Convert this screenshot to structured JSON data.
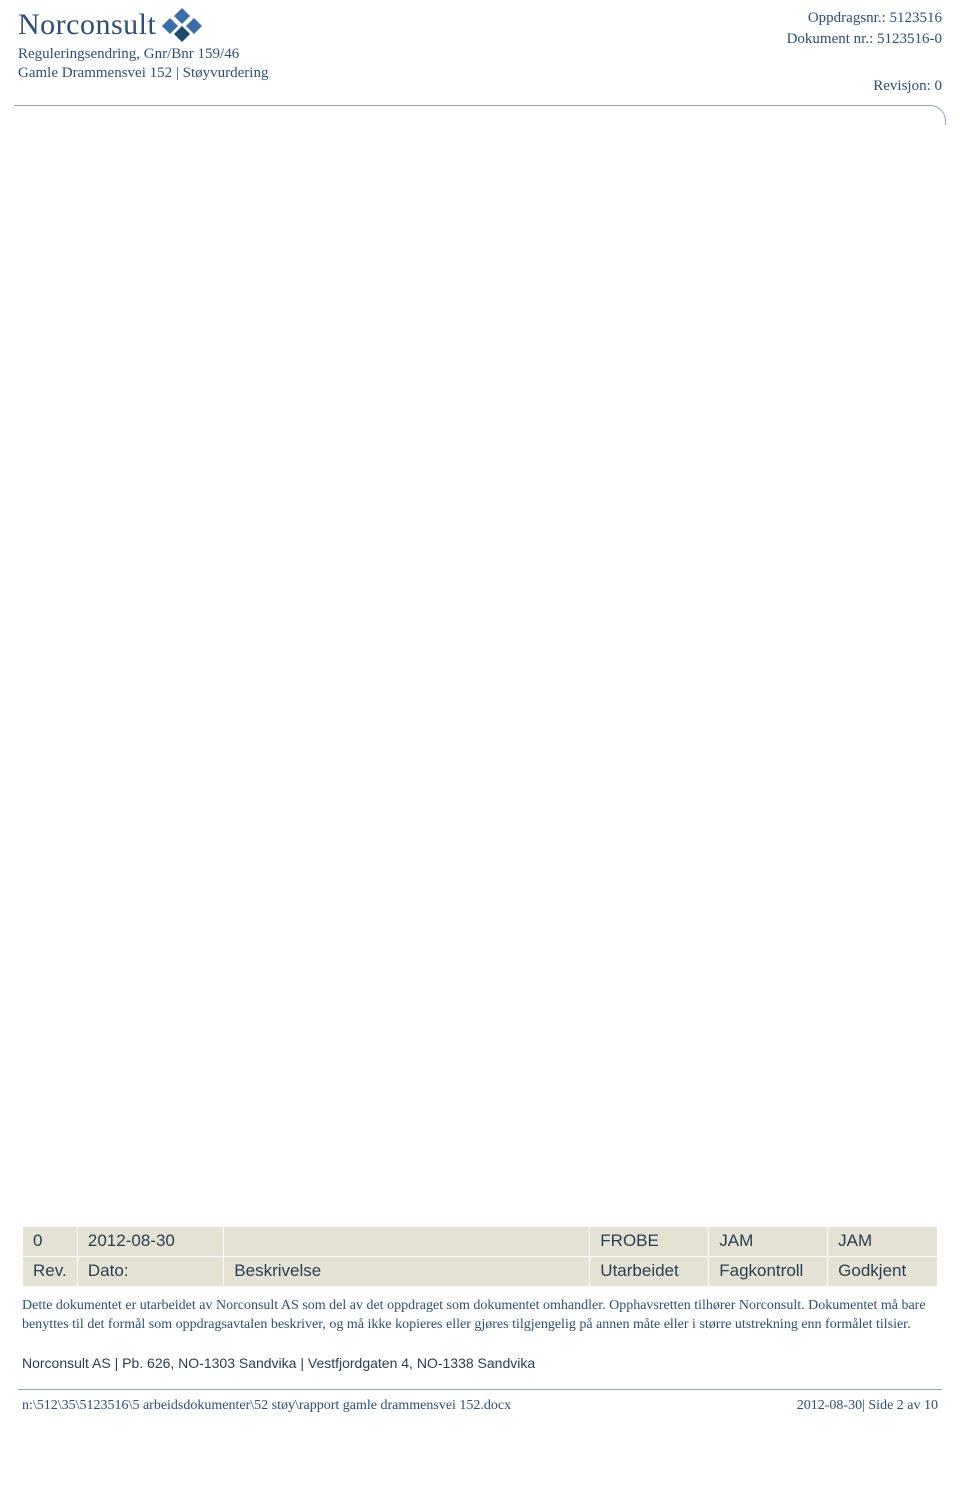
{
  "header": {
    "company": "Norconsult",
    "subline1": "Reguleringsendring, Gnr/Bnr 159/46",
    "subline2": "Gamle Drammensvei 152 | Støyvurdering",
    "oppdrag_label": "Oppdragsnr.:",
    "oppdrag_no": "5123516",
    "dokument_label": "Dokument nr.:",
    "dokument_no": "5123516-0",
    "revisjon_label": "Revisjon:",
    "revisjon_no": "0"
  },
  "rev_table": {
    "headers": {
      "rev": "Rev.",
      "date": "Dato:",
      "desc": "Beskrivelse",
      "utarbeidet": "Utarbeidet",
      "fagkontroll": "Fagkontroll",
      "godkjent": "Godkjent"
    },
    "row": {
      "rev": "0",
      "date": "2012-08-30",
      "desc": "",
      "utarbeidet": "FROBE",
      "fagkontroll": "JAM",
      "godkjent": "JAM"
    }
  },
  "disclaimer": "Dette dokumentet er utarbeidet av Norconsult AS som del av det oppdraget som dokumentet omhandler. Opphavsretten tilhører Norconsult. Dokumentet må bare benyttes til det formål som oppdragsavtalen beskriver, og må ikke kopieres eller gjøres tilgjengelig på annen måte eller i større utstrekning enn formålet tilsier.",
  "footer": {
    "address": "Norconsult AS | Pb. 626, NO-1303 Sandvika | Vestfjordgaten 4, NO-1338 Sandvika",
    "path": "n:\\512\\35\\5123516\\5 arbeidsdokumenter\\52 støy\\rapport gamle drammensvei 152.docx",
    "page": "2012-08-30| Side 2 av 10"
  }
}
